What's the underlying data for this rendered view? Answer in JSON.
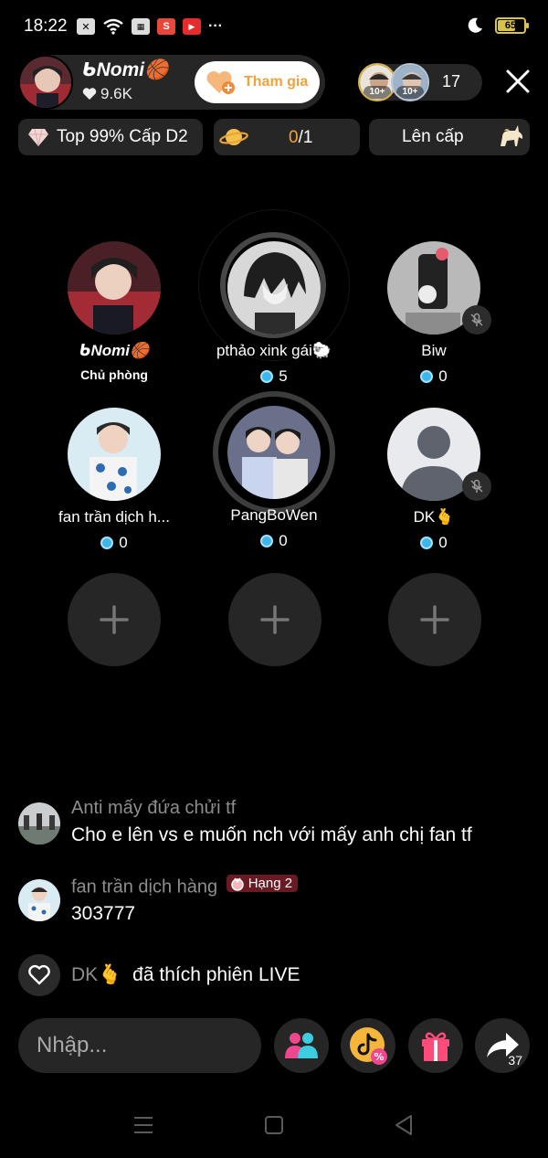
{
  "status_bar": {
    "time": "18:22",
    "battery": "65"
  },
  "host": {
    "name": "ᑲNomi🏀",
    "likes": "9.6K",
    "join_label": "Tham gia"
  },
  "viewers": {
    "badge1": "10+",
    "badge2": "10+",
    "count": "17"
  },
  "chips": {
    "rank": "Top 99% Cấp D2",
    "progress_current": "0",
    "progress_total": "/1",
    "level_up": "Lên cấp"
  },
  "seats": [
    {
      "name": "ᑲNomi🏀",
      "role": "Chủ phòng"
    },
    {
      "name": "pthảo xink gái🐑",
      "value": "5"
    },
    {
      "name": "Biw",
      "value": "0"
    },
    {
      "name": "fan trần dịch h...",
      "value": "0"
    },
    {
      "name": "PangBoWen",
      "value": "0"
    },
    {
      "name": "DK🫰",
      "value": "0"
    }
  ],
  "chat": [
    {
      "user": "Anti mấy đứa chửi tf",
      "text": "Cho e lên vs e muốn nch với mấy anh chị fan tf"
    },
    {
      "user": "fan trần dịch hàng",
      "badge": "Hạng 2",
      "text": "303777"
    }
  ],
  "like_event": {
    "user": "DK🫰",
    "text": "đã thích phiên LIVE"
  },
  "bottom": {
    "input_placeholder": "Nhập...",
    "share_count": "37"
  },
  "colors": {
    "accent_orange": "#f1a23a",
    "panel": "#262626",
    "coin": "#3fb6e9",
    "rank_badge": "#6a1a22"
  }
}
